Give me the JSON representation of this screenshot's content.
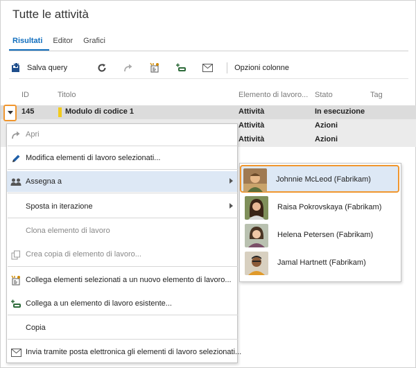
{
  "page": {
    "title": "Tutte le attività"
  },
  "tabs": [
    {
      "label": "Risultati",
      "active": true
    },
    {
      "label": "Editor",
      "active": false
    },
    {
      "label": "Grafici",
      "active": false
    }
  ],
  "toolbar": {
    "save_label": "Salva query",
    "options_label": "Opzioni colonne"
  },
  "grid": {
    "columns": [
      "ID",
      "Titolo",
      "Elemento di lavoro...",
      "Stato",
      "Tag"
    ],
    "rows": [
      {
        "id": "145",
        "title": "Modulo di codice 1",
        "type": "Attività",
        "state": "In esecuzione"
      },
      {
        "id": "",
        "title": "",
        "type": "Attività",
        "state": "Azioni"
      },
      {
        "id": "",
        "title": "",
        "type": "Attività",
        "state": "Azioni"
      }
    ]
  },
  "context_menu": {
    "items": [
      {
        "label": "Apri",
        "icon": "redo-arrow-icon",
        "disabled": true
      },
      {
        "label": "Modifica elementi di lavoro selezionati...",
        "icon": "pencil-icon"
      },
      {
        "label": "Assegna a",
        "icon": "people-icon",
        "submenu": true
      },
      {
        "label": "Sposta in iterazione",
        "icon": "",
        "submenu": true
      },
      {
        "label": "Clona elemento di lavoro",
        "icon": "",
        "disabled": true
      },
      {
        "label": "Crea copia di elemento di lavoro...",
        "icon": "copy-icon",
        "disabled": true
      },
      {
        "label": "Collega elementi selezionati a un nuovo elemento di lavoro...",
        "icon": "new-link-icon"
      },
      {
        "label": "Collega a un elemento di lavoro esistente...",
        "icon": "link-existing-icon"
      },
      {
        "label": "Copia",
        "icon": ""
      },
      {
        "label": "Invia tramite posta elettronica gli elementi di lavoro selezionati...",
        "icon": "mail-icon"
      }
    ]
  },
  "assign_submenu": {
    "people": [
      {
        "name": "Johnnie McLeod (Fabrikam)",
        "highlighted": true
      },
      {
        "name": "Raisa Pokrovskaya (Fabrikam)"
      },
      {
        "name": "Helena Petersen (Fabrikam)"
      },
      {
        "name": "Jamal Hartnett (Fabrikam)"
      }
    ]
  },
  "colors": {
    "accent": "#106ebe",
    "highlight_outline": "#f0962e",
    "hover": "#dde8f5",
    "work_item_swatch": "#f2cb1d"
  }
}
